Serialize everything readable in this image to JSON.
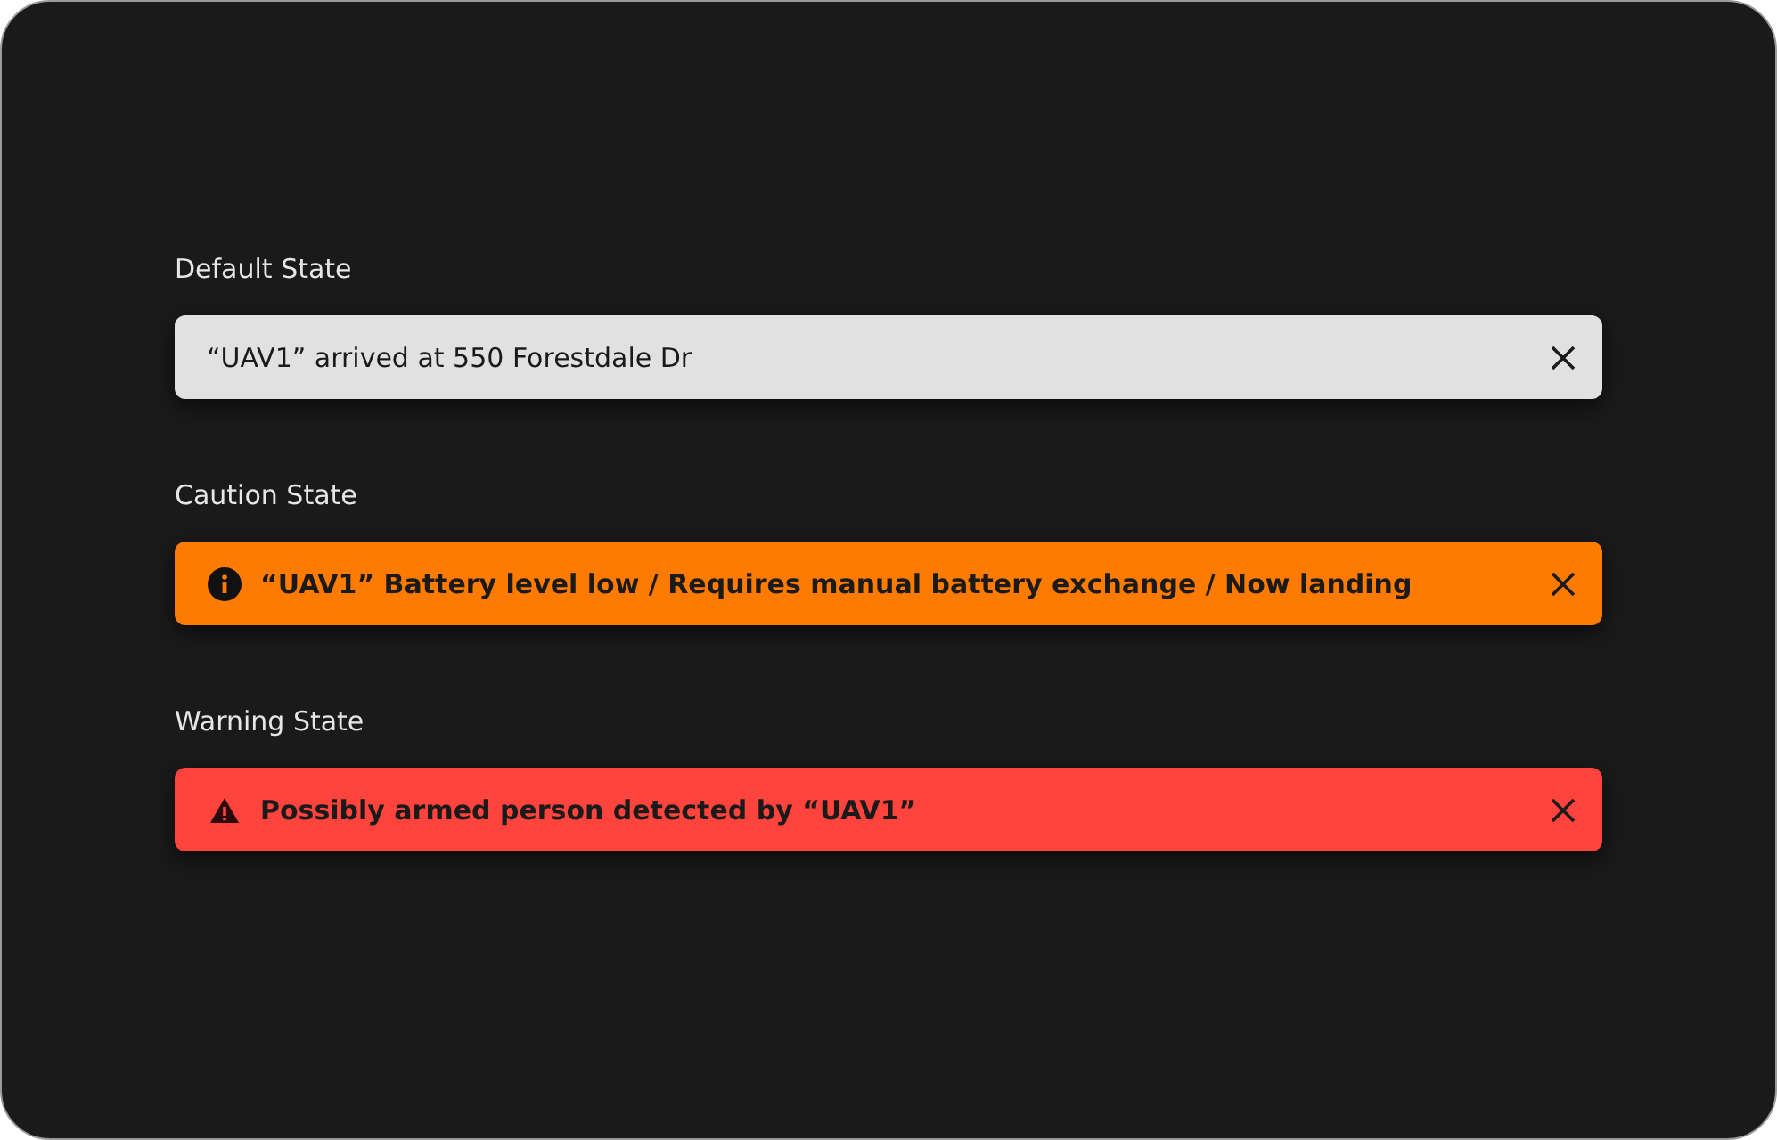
{
  "sections": [
    {
      "label": "Default State",
      "banner": {
        "kind": "default",
        "message": "“UAV1” arrived at 550 Forestdale Dr"
      }
    },
    {
      "label": "Caution State",
      "banner": {
        "kind": "caution",
        "message": "“UAV1” Battery level low / Requires manual battery exchange / Now landing"
      }
    },
    {
      "label": "Warning State",
      "banner": {
        "kind": "warning",
        "message": "Possibly armed person detected by “UAV1”"
      }
    }
  ]
}
